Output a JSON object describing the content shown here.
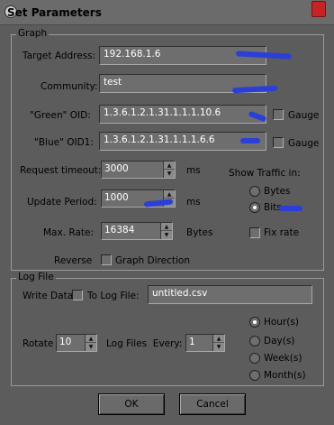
{
  "window": {
    "title": "Set Parameters"
  },
  "graph": {
    "group_label": "Graph",
    "target_address_label": "Target Address:",
    "target_address_value": "192.168.1.6",
    "community_label": "Community:",
    "community_value": "test",
    "green_oid_label": "\"Green\" OID:",
    "green_oid_value": "1.3.6.1.2.1.31.1.1.1.10.6",
    "blue_oid_label": "\"Blue\" OID1:",
    "blue_oid_value": "1.3.6.1.2.1.31.1.1.1.6.6",
    "gauge_label": "Gauge",
    "request_timeout_label": "Request timeout:",
    "request_timeout_value": "3000",
    "update_period_label": "Update Period:",
    "update_period_value": "1000",
    "ms_label": "ms",
    "max_rate_label": "Max. Rate:",
    "max_rate_value": "16384",
    "bytes_unit_label": "Bytes",
    "show_traffic_label": "Show Traffic in:",
    "traffic_bytes_label": "Bytes",
    "traffic_bits_label": "Bits",
    "fix_rate_label": "Fix rate",
    "reverse_label": "Reverse",
    "graph_direction_label": "Graph Direction"
  },
  "log": {
    "group_label": "Log File",
    "write_data_label": "Write Data",
    "to_log_file_label": "To Log File:",
    "log_file_value": "untitled.csv",
    "rotate_label": "Rotate",
    "rotate_value": "10",
    "log_files_every_label": "Log Files  Every:",
    "every_value": "1",
    "hours_label": "Hour(s)",
    "days_label": "Day(s)",
    "weeks_label": "Week(s)",
    "months_label": "Month(s)"
  },
  "buttons": {
    "ok": "OK",
    "cancel": "Cancel"
  },
  "spin_up_glyph": "▲",
  "spin_down_glyph": "▼"
}
